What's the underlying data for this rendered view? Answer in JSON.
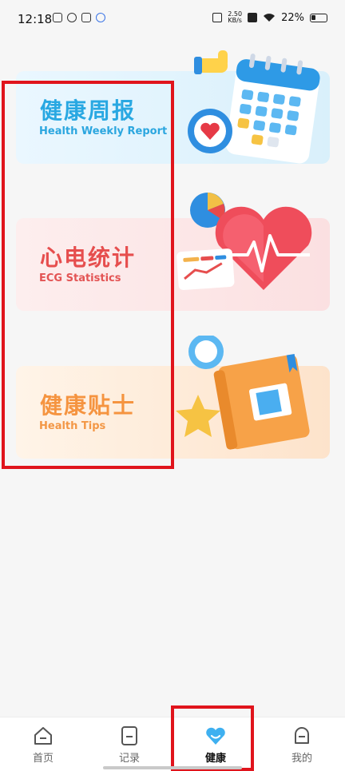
{
  "status_bar": {
    "time": "12:18",
    "net_speed_value": "2.50",
    "net_speed_unit": "KB/s",
    "battery": "22%"
  },
  "cards": [
    {
      "title": "健康周报",
      "subtitle": "Health Weekly Report",
      "accent": "#29a8e2"
    },
    {
      "title": "心电统计",
      "subtitle": "ECG Statistics",
      "accent": "#e64e4e"
    },
    {
      "title": "健康贴士",
      "subtitle": "Health Tips",
      "accent": "#f59440"
    }
  ],
  "tabbar": {
    "tabs": [
      {
        "label": "首页",
        "icon": "home-icon"
      },
      {
        "label": "记录",
        "icon": "record-icon"
      },
      {
        "label": "健康",
        "icon": "health-heart-icon",
        "active": true
      },
      {
        "label": "我的",
        "icon": "profile-icon"
      }
    ]
  },
  "colors": {
    "highlight": "#e0141c",
    "tab_active": "#3fb0f0"
  }
}
